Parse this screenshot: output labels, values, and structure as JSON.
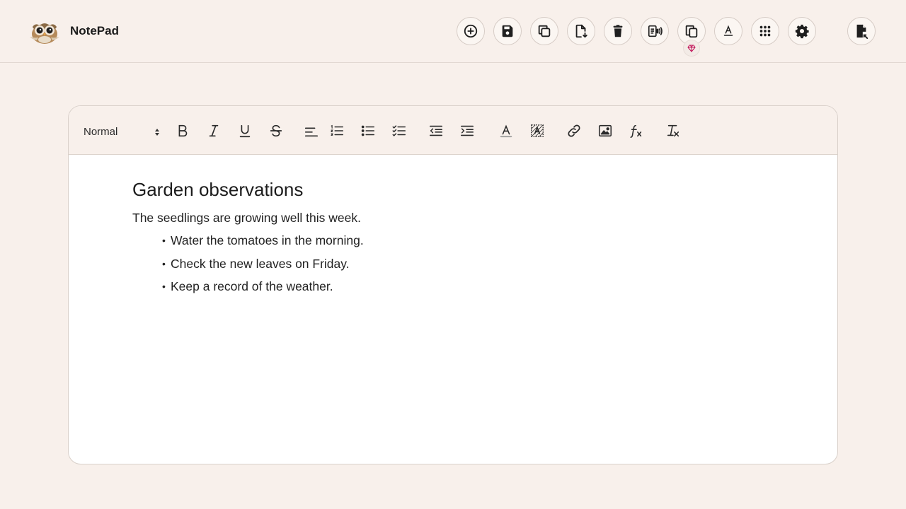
{
  "app": {
    "title": "NotePad"
  },
  "header": {
    "buttons": [
      {
        "name": "new-note-button",
        "icon": "plus-circle-icon"
      },
      {
        "name": "save-button",
        "icon": "floppy-disk-icon"
      },
      {
        "name": "duplicate-button",
        "icon": "copy-icon"
      },
      {
        "name": "download-button",
        "icon": "file-download-icon"
      },
      {
        "name": "delete-button",
        "icon": "trash-icon"
      },
      {
        "name": "read-aloud-button",
        "icon": "document-speaker-icon"
      },
      {
        "name": "copy-all-button",
        "icon": "copy-pages-icon"
      },
      {
        "name": "font-button",
        "icon": "text-format-icon"
      },
      {
        "name": "apps-button",
        "icon": "grid-dots-icon"
      },
      {
        "name": "settings-button",
        "icon": "gear-icon"
      },
      {
        "name": "export-button",
        "icon": "file-export-icon"
      }
    ],
    "pro_badge_icon": "gem-icon"
  },
  "toolbar": {
    "format_select": {
      "value": "Normal",
      "options": [
        "Normal"
      ]
    },
    "tools": [
      "bold",
      "italic",
      "underline",
      "strikethrough",
      "align-left",
      "ordered-list",
      "bullet-list",
      "check-list",
      "outdent",
      "indent",
      "text-color",
      "background-color",
      "link",
      "image",
      "formula",
      "clear-formatting"
    ]
  },
  "document": {
    "heading": "Garden observations",
    "paragraph": "The seedlings are growing well this week.",
    "list": [
      "Water the tomatoes in the morning.",
      "Check the new leaves on Friday.",
      "Keep a record of the weather."
    ]
  },
  "colors": {
    "background": "#f8f0eb",
    "editor_background": "#ffffff",
    "icon": "#1f1f1f",
    "badge_accent": "#c2185b"
  }
}
